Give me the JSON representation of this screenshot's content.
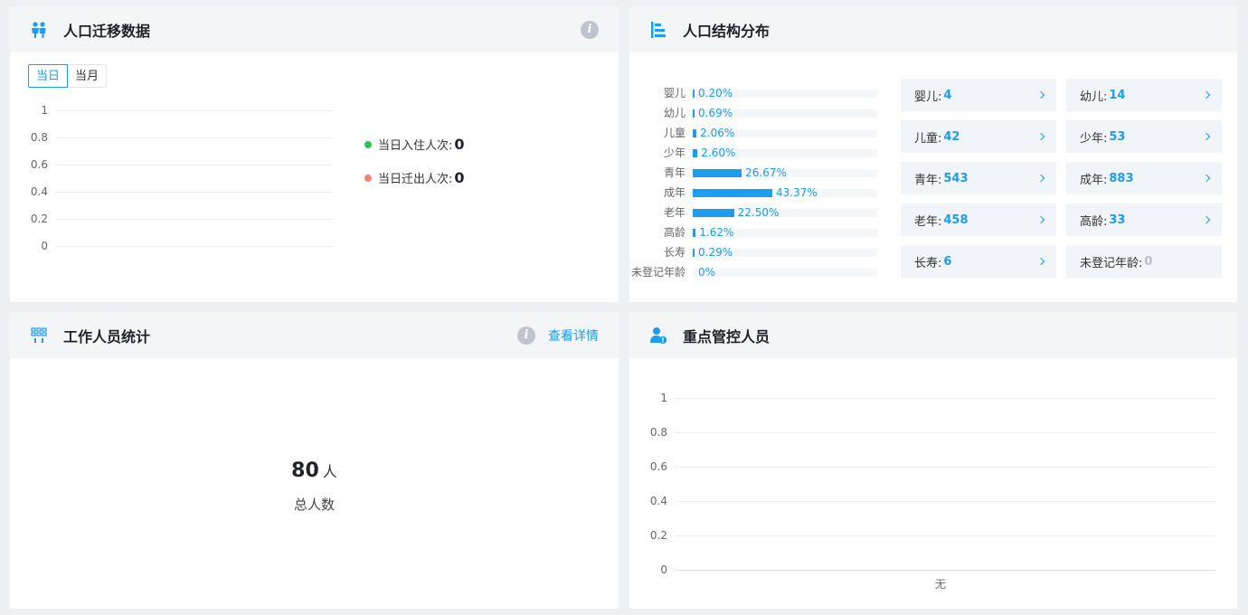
{
  "migration": {
    "title": "人口迁移数据",
    "tabs": [
      "当日",
      "当月"
    ],
    "y_ticks": [
      "1",
      "0.8",
      "0.6",
      "0.4",
      "0.2",
      "0"
    ],
    "legend": [
      {
        "label": "当日入住人次:",
        "value": "0",
        "color": "#2fc25b"
      },
      {
        "label": "当日迁出人次:",
        "value": "0",
        "color": "#f0837a"
      }
    ]
  },
  "structure": {
    "title": "人口结构分布",
    "bars": [
      {
        "label": "婴儿",
        "pct": "0.20%",
        "value": 0.2
      },
      {
        "label": "幼儿",
        "pct": "0.69%",
        "value": 0.69
      },
      {
        "label": "儿童",
        "pct": "2.06%",
        "value": 2.06
      },
      {
        "label": "少年",
        "pct": "2.60%",
        "value": 2.6
      },
      {
        "label": "青年",
        "pct": "26.67%",
        "value": 26.67
      },
      {
        "label": "成年",
        "pct": "43.37%",
        "value": 43.37
      },
      {
        "label": "老年",
        "pct": "22.50%",
        "value": 22.5
      },
      {
        "label": "高龄",
        "pct": "1.62%",
        "value": 1.62
      },
      {
        "label": "长寿",
        "pct": "0.29%",
        "value": 0.29
      },
      {
        "label": "未登记年龄",
        "pct": "0%",
        "value": 0
      }
    ],
    "cards": [
      {
        "label": "婴儿:",
        "value": "4",
        "arrow": true
      },
      {
        "label": "幼儿:",
        "value": "14",
        "arrow": true
      },
      {
        "label": "儿童:",
        "value": "42",
        "arrow": true
      },
      {
        "label": "少年:",
        "value": "53",
        "arrow": true
      },
      {
        "label": "青年:",
        "value": "543",
        "arrow": true
      },
      {
        "label": "成年:",
        "value": "883",
        "arrow": true
      },
      {
        "label": "老年:",
        "value": "458",
        "arrow": true
      },
      {
        "label": "高龄:",
        "value": "33",
        "arrow": true
      },
      {
        "label": "长寿:",
        "value": "6",
        "arrow": true
      },
      {
        "label": "未登记年龄:",
        "value": "0",
        "arrow": false
      }
    ]
  },
  "staff": {
    "title": "工作人员统计",
    "detail_link": "查看详情",
    "total": "80",
    "unit": "人",
    "total_label": "总人数"
  },
  "key_people": {
    "title": "重点管控人员",
    "y_ticks": [
      "1",
      "0.8",
      "0.6",
      "0.4",
      "0.2",
      "0"
    ],
    "x_label": "无"
  },
  "colors": {
    "accent": "#1e9cf0",
    "in_dot": "#2fc25b",
    "out_dot": "#f0837a"
  },
  "chart_data": [
    {
      "type": "bar",
      "title": "人口结构分布",
      "orientation": "horizontal",
      "categories": [
        "婴儿",
        "幼儿",
        "儿童",
        "少年",
        "青年",
        "成年",
        "老年",
        "高龄",
        "长寿",
        "未登记年龄"
      ],
      "values": [
        0.2,
        0.69,
        2.06,
        2.6,
        26.67,
        43.37,
        22.5,
        1.62,
        0.29,
        0
      ],
      "unit": "%"
    },
    {
      "type": "line",
      "title": "人口迁移数据",
      "ylim": [
        0,
        1
      ],
      "series": [
        {
          "name": "当日入住人次",
          "values": []
        },
        {
          "name": "当日迁出人次",
          "values": []
        }
      ]
    },
    {
      "type": "bar",
      "title": "重点管控人员",
      "categories": [
        "无"
      ],
      "values": [
        0
      ],
      "ylim": [
        0,
        1
      ]
    }
  ]
}
